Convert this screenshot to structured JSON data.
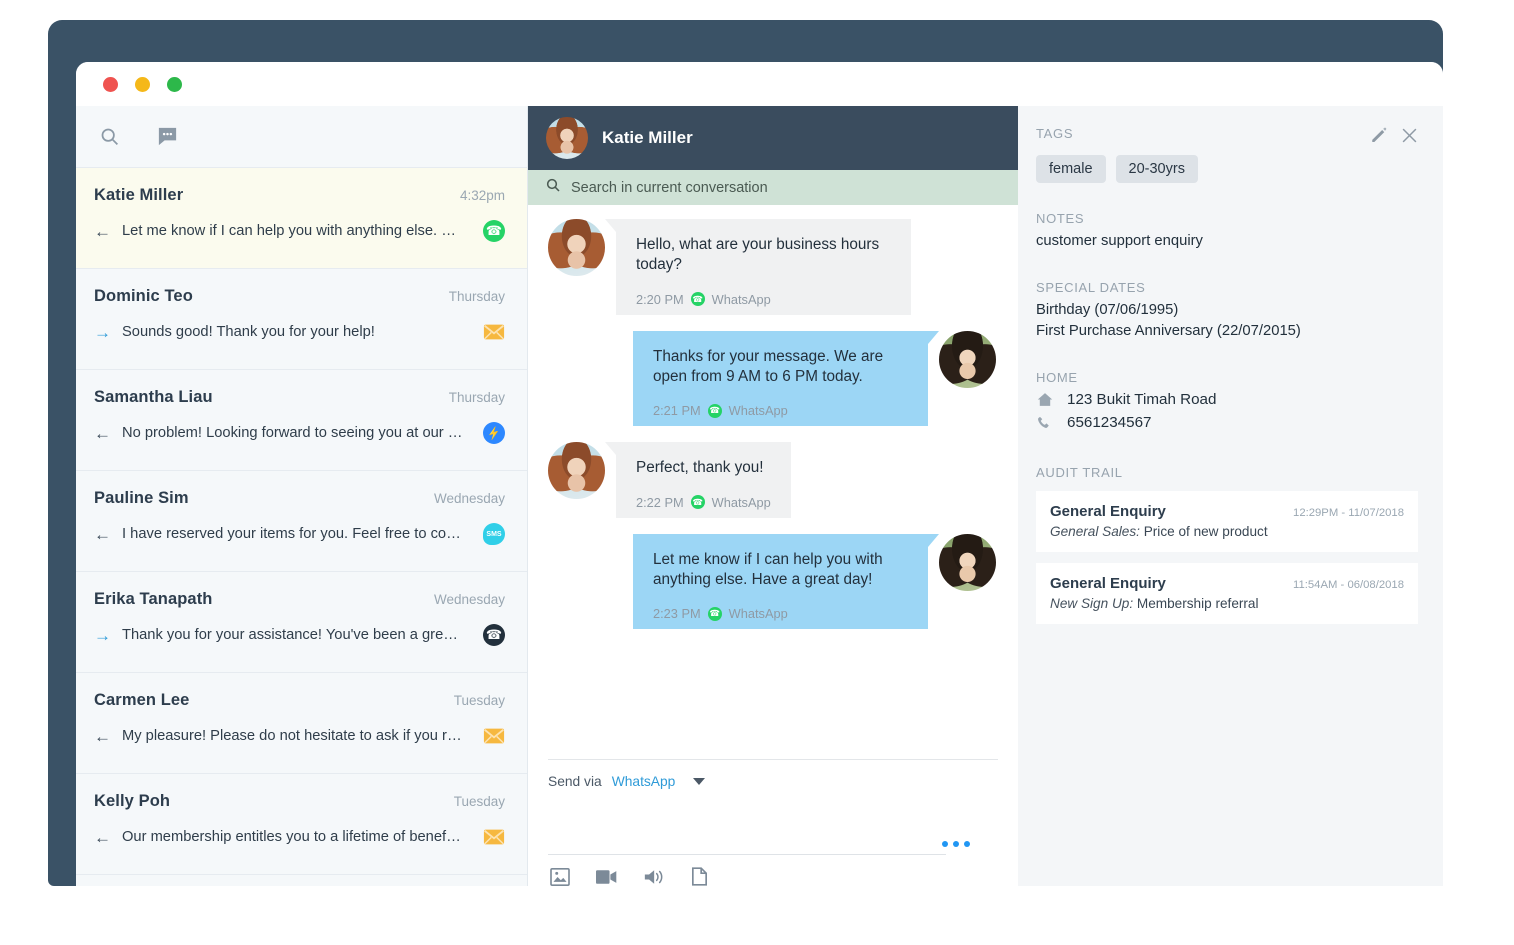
{
  "window": {
    "traffic_lights": [
      "close",
      "minimize",
      "maximize"
    ]
  },
  "conversation_list": {
    "toolbar": {
      "search_icon": "search-icon",
      "compose_icon": "chat-bubble-icon"
    },
    "items": [
      {
        "name": "Katie Miller",
        "time": "4:32pm",
        "direction": "in",
        "arrow": "←",
        "preview": "Let me know if I can help you with anything else. Have a gr…",
        "channel": "whatsapp",
        "active": true
      },
      {
        "name": "Dominic Teo",
        "time": "Thursday",
        "direction": "out",
        "arrow": "→",
        "preview": "Sounds good! Thank you for your help!",
        "channel": "email",
        "active": false
      },
      {
        "name": "Samantha Liau",
        "time": "Thursday",
        "direction": "in",
        "arrow": "←",
        "preview": "No problem! Looking forward to seeing you at our store th…",
        "channel": "messenger",
        "active": false
      },
      {
        "name": "Pauline Sim",
        "time": "Wednesday",
        "direction": "in",
        "arrow": "←",
        "preview": "I have reserved your items for you. Feel free to come down …",
        "channel": "sms",
        "active": false
      },
      {
        "name": "Erika Tanapath",
        "time": "Wednesday",
        "direction": "out",
        "arrow": "→",
        "preview": "Thank you for your assistance! You've been a great help!",
        "channel": "call",
        "active": false
      },
      {
        "name": "Carmen Lee",
        "time": "Tuesday",
        "direction": "in",
        "arrow": "←",
        "preview": "My pleasure! Please do not hesitate to ask if you require fur…",
        "channel": "email",
        "active": false
      },
      {
        "name": "Kelly Poh",
        "time": "Tuesday",
        "direction": "in",
        "arrow": "←",
        "preview": "Our membership entitles you to a lifetime of benefits with …",
        "channel": "email",
        "active": false
      }
    ]
  },
  "conversation": {
    "header": {
      "contact_name": "Katie Miller"
    },
    "search": {
      "placeholder": "Search in current conversation",
      "icon": "search-icon"
    },
    "messages": [
      {
        "direction": "in",
        "text": "Hello, what are your business hours today?",
        "time": "2:20 PM",
        "channel": "WhatsApp"
      },
      {
        "direction": "out",
        "text": "Thanks for your message. We are open from 9 AM to 6 PM today.",
        "time": "2:21 PM",
        "channel": "WhatsApp"
      },
      {
        "direction": "in",
        "text": "Perfect, thank you!",
        "time": "2:22 PM",
        "channel": "WhatsApp"
      },
      {
        "direction": "out",
        "text": "Let me know if I can help you with anything else. Have a great day!",
        "time": "2:23 PM",
        "channel": "WhatsApp"
      }
    ],
    "composer": {
      "send_via_label": "Send via",
      "send_via_value": "WhatsApp",
      "caret_icon": "chevron-down-icon",
      "message_placeholder": "",
      "typing_indicator": "•••",
      "attachments": [
        {
          "icon": "image-icon",
          "label": "Image"
        },
        {
          "icon": "video-icon",
          "label": "Video"
        },
        {
          "icon": "audio-icon",
          "label": "Audio"
        },
        {
          "icon": "document-icon",
          "label": "Document"
        }
      ]
    }
  },
  "profile": {
    "tags_label": "TAGS",
    "edit_icon": "pencil-icon",
    "close_icon": "close-icon",
    "tags": [
      "female",
      "20-30yrs"
    ],
    "notes_label": "NOTES",
    "notes_value": "customer support enquiry",
    "special_dates_label": "SPECIAL DATES",
    "special_dates": [
      "Birthday (07/06/1995)",
      "First Purchase Anniversary (22/07/2015)"
    ],
    "home_label": "HOME",
    "home": [
      {
        "icon": "home-icon",
        "value": "123 Bukit Timah Road"
      },
      {
        "icon": "phone-icon",
        "value": "6561234567"
      }
    ],
    "audit_label": "AUDIT TRAIL",
    "audit_entries": [
      {
        "title": "General Enquiry",
        "timestamp": "12:29PM - 11/07/2018",
        "category": "General Sales:",
        "detail": "Price of new product"
      },
      {
        "title": "General Enquiry",
        "timestamp": "11:54AM - 06/08/2018",
        "category": "New Sign Up:",
        "detail": "Membership referral"
      }
    ]
  },
  "colors": {
    "frame": "#3a5266",
    "header": "#3a4c5e",
    "search_bar": "#cfe2d6",
    "bubble_in": "#f0f1f2",
    "bubble_out": "#9cd6f5",
    "accent_link": "#2f9bd8",
    "active_row": "#fbfbee",
    "panel_bg": "#f4f6f8"
  }
}
